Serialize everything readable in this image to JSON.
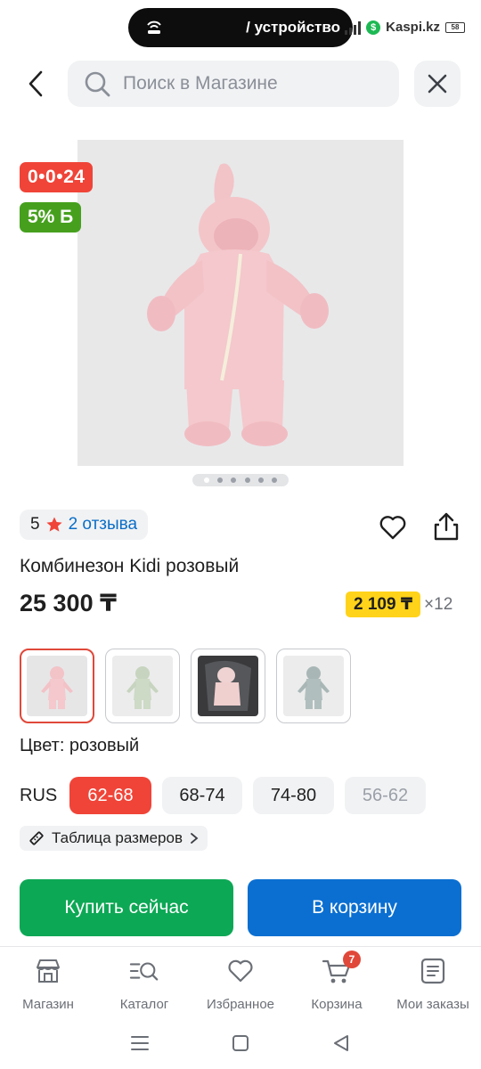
{
  "status_bar": {
    "pill_text": "/ устройство",
    "site_label": "Kaspi.kz",
    "battery": "58"
  },
  "search": {
    "placeholder": "Поиск в Магазине"
  },
  "badges": {
    "timer": "0•0•24",
    "discount": "5% Б"
  },
  "gallery": {
    "image_count": 6,
    "active_index": 0
  },
  "rating": {
    "score": "5",
    "reviews": "2 отзыва"
  },
  "product": {
    "title": "Комбинезон Kidi розовый",
    "price": "25 300 ₸",
    "installment_amount": "2 109 ₸",
    "installment_times": "×12"
  },
  "colors": {
    "label": "Цвет: розовый",
    "options": [
      "розовый",
      "зелёный",
      "розовый в автокресле",
      "серо-голубой"
    ],
    "selected": 0
  },
  "sizes": {
    "system": "RUS",
    "options": [
      "62-68",
      "68-74",
      "74-80",
      "56-62"
    ],
    "selected": 0,
    "unavailable": [
      3
    ]
  },
  "size_table": {
    "label": "Таблица размеров"
  },
  "actions": {
    "buy_now": "Купить сейчас",
    "add_to_cart": "В корзину"
  },
  "bottom_nav": {
    "items": [
      {
        "label": "Магазин",
        "icon": "store-icon"
      },
      {
        "label": "Каталог",
        "icon": "catalog-search-icon"
      },
      {
        "label": "Избранное",
        "icon": "heart-icon"
      },
      {
        "label": "Корзина",
        "icon": "cart-icon"
      },
      {
        "label": "Мои заказы",
        "icon": "orders-icon"
      }
    ],
    "cart_count": "7"
  },
  "colors_theme": {
    "primary_red": "#f04438",
    "primary_green": "#0da855",
    "primary_blue": "#0b6fd1",
    "discount_green": "#46a01e",
    "installment_yellow": "#ffd31a"
  }
}
